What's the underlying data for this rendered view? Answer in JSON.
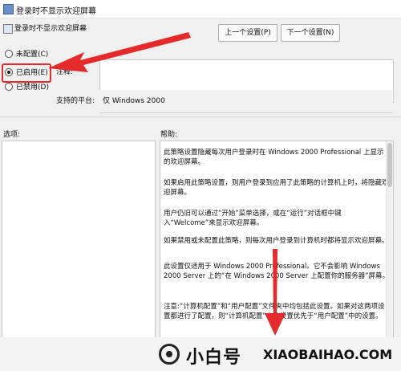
{
  "window": {
    "title": "登录时不显示欢迎屏幕",
    "policy_name": "登录时不显示欢迎屏幕"
  },
  "nav": {
    "prev": "上一个设置(P)",
    "next": "下一个设置(N)"
  },
  "radios": [
    {
      "label": "未配置(C)",
      "checked": false
    },
    {
      "label": "已启用(E)",
      "checked": true
    },
    {
      "label": "已禁用(D)",
      "checked": false
    }
  ],
  "labels": {
    "comment": "注释:",
    "platform": "支持的平台:",
    "options": "选项:",
    "help": "帮助:"
  },
  "platform_value": "仅 Windows 2000",
  "help_paragraphs": [
    "此策略设置隐藏每次用户登录时在 Windows 2000 Professional 上显示的欢迎屏幕。",
    "如果启用此策略设置，则用户登录到应用了此策略的计算机上时，将隐藏欢迎屏幕。",
    "用户仍旧可以通过“开始”菜单选择，或在“运行”对话框中键入“Welcome”来显示欢迎屏幕。",
    "如果禁用或未配置此策略，则每次用户登录到计算机时都将显示欢迎屏幕。",
    "此设置仅适用于 Windows 2000 Professional。它不会影响 Windows 2000 Server 上的“在 Windows 2000 Server 上配置你的服务器”屏幕。",
    "注意:“计算机配置”和“用户配置”文件夹中均包括此设置。如果对这两项设置都进行了配置，则“计算机配置”中的设置优先于“用户配置”中的设置。"
  ],
  "watermark": {
    "brand": "小白号",
    "url": "XIAOBAIHAO.COM"
  },
  "colors": {
    "highlight": "#e42a2a",
    "arrow": "#e42a2a"
  }
}
